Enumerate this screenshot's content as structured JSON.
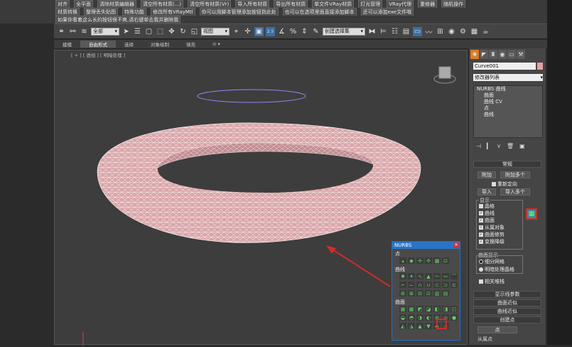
{
  "menu_rows": [
    [
      "对齐",
      "全平面",
      "清除材质编辑器",
      "清空所有材质(...)",
      "清空所有材质(Vr)",
      "导入所有材质",
      "导出所有材质",
      "单文件VRay材质",
      "灯光管理",
      "VRay代理",
      "重修器",
      "随机操作"
    ],
    [
      "材质转换",
      "整理丢失贴图",
      "特殊功能",
      "修改所有VRayMtl",
      "你可以用脚本管理添加按钮到此处",
      "也可以在选项里面直接添加脚本",
      "还可以添加exe文件哦"
    ],
    [
      "如果你看着这么长的按钮很不爽,请右键单击我并删除我"
    ]
  ],
  "toolbar": {
    "filter_value": "全部",
    "view_value": "视图",
    "selection_set_placeholder": "创建选择集",
    "snap_label": "2.5"
  },
  "ribbon_tabs": [
    {
      "label": "建模",
      "active": false
    },
    {
      "label": "自由形式",
      "active": true
    },
    {
      "label": "选择",
      "active": false
    },
    {
      "label": "对象绘制",
      "active": false
    },
    {
      "label": "填充",
      "active": false
    },
    {
      "label": "⊙ ▾",
      "active": false
    }
  ],
  "viewport": {
    "label": "[ + ] [ 透视 ] [ 明暗处理 ]",
    "mesh_color": "#d9a5a8"
  },
  "command_panel": {
    "object_name": "Curve001",
    "object_color": "#e8a0a0",
    "modifier_list": "修改器列表",
    "stack": [
      "NURBS 曲线",
      "曲面",
      "曲线 CV",
      "点",
      "曲线"
    ],
    "general_header": "常规",
    "attach_label": "附加",
    "attach_multi_label": "附加多个",
    "reorient_label": "重新定向",
    "import_label": "导入",
    "import_multi_label": "导入多个",
    "display_title": "显示",
    "display_items": [
      "晶格",
      "曲线",
      "曲面",
      "从属对象",
      "曲面修剪",
      "变换降级"
    ],
    "display_checked": [
      false,
      true,
      true,
      true,
      true,
      true
    ],
    "surface_display_title": "曲面显示",
    "surface_display_items": [
      "细分网格",
      "明暗处理晶格"
    ],
    "relational_stack_label": "相关堆栈",
    "rollouts": [
      "显示线参数",
      "曲面近似",
      "曲线近似",
      "创建点"
    ],
    "point_button": "点",
    "dependent_point_label": "从属点"
  },
  "nurbs_panel": {
    "title": "NURBS",
    "close": "✕",
    "sections": [
      "点",
      "曲线",
      "曲面"
    ]
  },
  "accent_color": "#d42a2a"
}
